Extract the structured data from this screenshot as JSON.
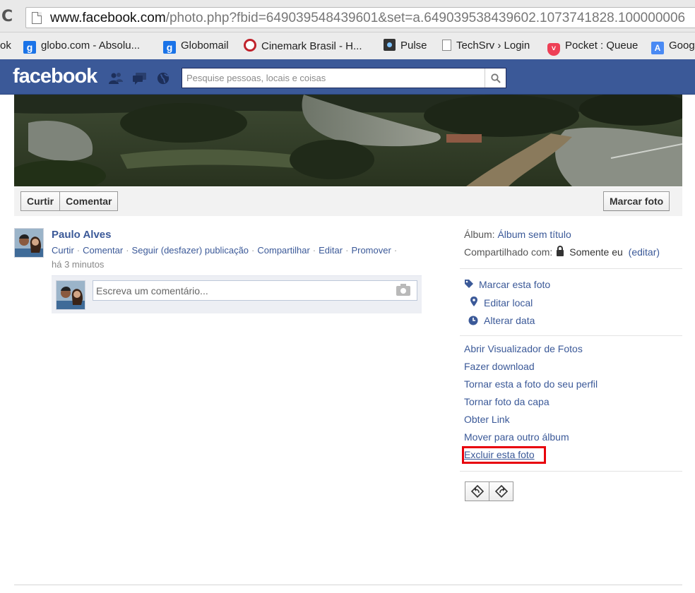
{
  "browser": {
    "url_host": "www.facebook.com",
    "url_rest": "/photo.php?fbid=649039548439601&set=a.649039538439602.1073741828.100000006",
    "bookmarks": [
      {
        "label": "ok",
        "icon": "bookmark-fragment"
      },
      {
        "label": "globo.com - Absolu...",
        "icon": "globo-g-icon",
        "color": "#1a73e8"
      },
      {
        "label": "Globomail",
        "icon": "globo-g-icon",
        "color": "#1a73e8"
      },
      {
        "label": "Cinemark Brasil - H...",
        "icon": "cinemark-icon",
        "color": "#c0232c"
      },
      {
        "label": "Pulse",
        "icon": "pulse-icon",
        "color": "#333333"
      },
      {
        "label": "TechSrv › Login",
        "icon": "page-icon"
      },
      {
        "label": "Pocket : Queue",
        "icon": "pocket-icon",
        "color": "#ee4056"
      },
      {
        "label": "Goog",
        "icon": "google-translate-icon",
        "color": "#4a8af4"
      }
    ]
  },
  "facebook": {
    "logo": "facebook",
    "search_placeholder": "Pesquise pessoas, locais e coisas",
    "brand_color": "#3b5998"
  },
  "photo_actions": {
    "like": "Curtir",
    "comment": "Comentar",
    "tag": "Marcar foto"
  },
  "post": {
    "author": "Paulo Alves",
    "actions": [
      "Curtir",
      "Comentar",
      "Seguir (desfazer) publicação",
      "Compartilhar",
      "Editar",
      "Promover"
    ],
    "time": "há 3 minutos",
    "comment_placeholder": "Escreva um comentário..."
  },
  "sidebar": {
    "album_label": "Álbum:",
    "album_value": "Álbum sem título",
    "shared_label": "Compartilhado com:",
    "shared_value": "Somente eu",
    "shared_edit": "(editar)",
    "photo_actions": [
      {
        "label": "Marcar esta foto",
        "icon": "tag-icon"
      },
      {
        "label": "Editar local",
        "icon": "location-pin-icon"
      },
      {
        "label": "Alterar data",
        "icon": "clock-icon"
      }
    ],
    "options": [
      "Abrir Visualizador de Fotos",
      "Fazer download",
      "Tornar esta a foto do seu perfil",
      "Tornar foto da capa",
      "Obter Link",
      "Mover para outro álbum",
      "Excluir esta foto"
    ],
    "highlight_color": "#e8000b"
  }
}
